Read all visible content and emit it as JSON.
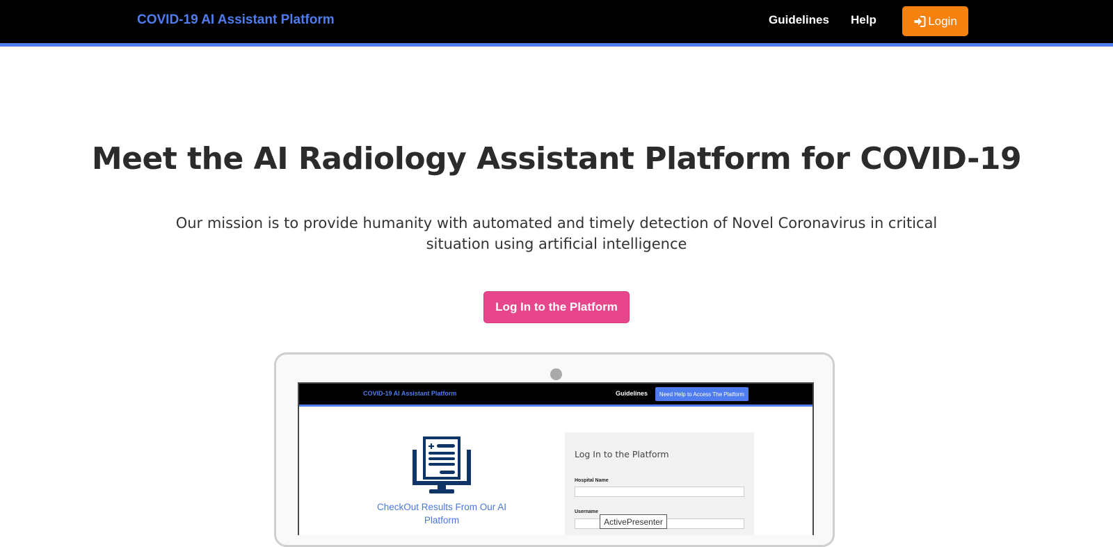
{
  "header": {
    "brand": "COVID-19 AI Assistant Platform",
    "nav": {
      "guidelines": "Guidelines",
      "help": "Help"
    },
    "login_label": "Login",
    "login_icon": "sign-in-icon",
    "colors": {
      "bar": "#000000",
      "accent": "#4f7df0",
      "login": "#f5820e"
    }
  },
  "hero": {
    "title": "Meet the AI Radiology Assistant Platform for COVID-19",
    "subtitle": "Our mission is to provide humanity with automated and timely detection of Novel Coronavirus in critical situation using artificial intelligence",
    "cta_label": "Log In to the Platform",
    "cta_color": "#e8468c"
  },
  "mockup": {
    "brand": "COVID-19 AI Assistant Platform",
    "guidelines": "Guidelines",
    "help_button": "Need Help to Access The Platform",
    "icon": "medical-report-monitor-icon",
    "caption": "CheckOut Results From Our AI Platform",
    "panel_title": "Log In to the Platform",
    "hospital_label": "Hospital Name",
    "username_label": "Username"
  },
  "watermark": "ActivePresenter"
}
